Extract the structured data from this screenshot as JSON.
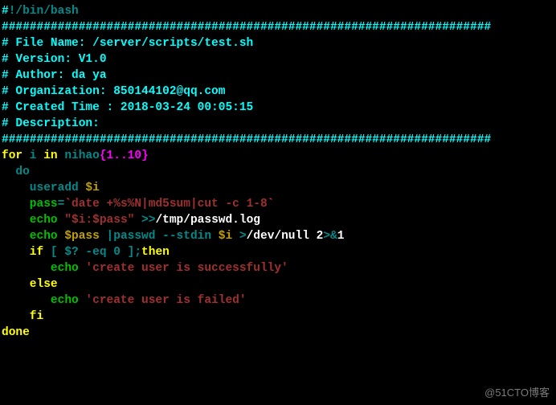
{
  "shebang": {
    "hash": "#",
    "bang": "!/bin/bash"
  },
  "ruler": "######################################################################",
  "header": {
    "file": "# File Name: /server/scripts/test.sh",
    "version": "# Version: V1.0",
    "author": "# Author: da ya",
    "org": "# Organization: 850144102@qq.com",
    "created": "# Created Time : 2018-03-24 00:05:15",
    "desc": "# Description:"
  },
  "code": {
    "for_kw": "for",
    "for_rest": " i ",
    "in_kw": "in",
    "in_rest": " nihao",
    "brace": "{1..10}",
    "do": "  do",
    "useradd_cmd": "    useradd ",
    "useradd_arg": "$i",
    "pass_lhs": "    pass",
    "eq": "=",
    "btick_open": "`",
    "date_cmd": "date +%s%N|md5sum|cut -c 1-8",
    "btick_close": "`",
    "echo1_cmd": "    echo",
    "echo1_str": " \"$i:$pass\" ",
    "echo1_redir": ">>",
    "echo1_path": "/tmp/passwd.log",
    "echo2_cmd": "    echo",
    "echo2_var": " $pass ",
    "echo2_pipe_cmd": "|passwd --stdin ",
    "echo2_arg": "$i ",
    "echo2_redir": ">",
    "echo2_dn": "/dev/null ",
    "echo2_two": "2",
    "echo2_amp": ">&",
    "echo2_one": "1",
    "if_kw": "    if",
    "if_test": " [ $? -eq 0 ];",
    "then_kw": "then",
    "echo_ok_cmd": "       echo ",
    "echo_ok_str": "'create user is successfully'",
    "else_kw": "    else",
    "echo_fail_cmd": "       echo ",
    "echo_fail_str": "'create user is failed'",
    "fi_kw": "    fi",
    "done_kw": "done"
  },
  "watermark": "@51CTO博客"
}
